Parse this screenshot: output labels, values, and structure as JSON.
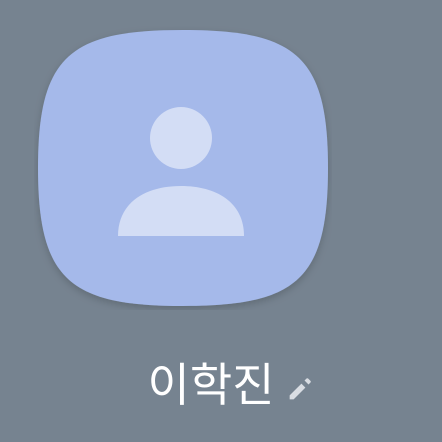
{
  "contact": {
    "name": "이학진",
    "avatar_icon": "person-silhouette-icon",
    "edit_icon": "pencil-icon"
  },
  "colors": {
    "background": "#768390",
    "avatar_fill": "#A5B9EA",
    "silhouette_fill": "#D3DDF5",
    "name_text": "#FFFFFF",
    "edit_icon": "#D9DDE3"
  }
}
